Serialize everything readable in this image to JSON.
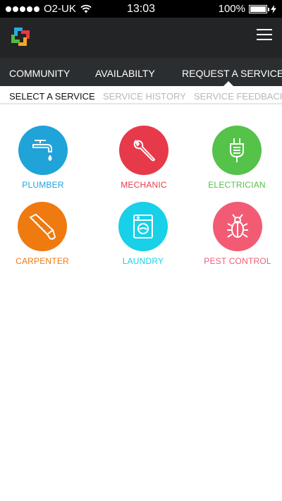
{
  "status_bar": {
    "carrier": "O2-UK",
    "time": "13:03",
    "battery": "100%",
    "battery_level": 1.0
  },
  "header": {
    "logo_icon": "app-logo-icon",
    "menu_icon": "hamburger-menu-icon"
  },
  "nav": {
    "items": [
      {
        "label": "COMMUNITY"
      },
      {
        "label": "AVAILABILTY"
      },
      {
        "label": "REQUEST A SERVICE",
        "selected": true
      }
    ]
  },
  "sub_tabs": {
    "items": [
      {
        "label": "SELECT A SERVICE",
        "active": true
      },
      {
        "label": "SERVICE HISTORY"
      },
      {
        "label": "SERVICE FEEDBACK"
      }
    ]
  },
  "services": [
    {
      "label": "PLUMBER",
      "icon": "faucet-icon",
      "color": "#1fa3d8"
    },
    {
      "label": "MECHANIC",
      "icon": "wrench-icon",
      "color": "#e63a4a"
    },
    {
      "label": "ELECTRICIAN",
      "icon": "plug-icon",
      "color": "#55c24a"
    },
    {
      "label": "CARPENTER",
      "icon": "saw-icon",
      "color": "#ee7a10"
    },
    {
      "label": "LAUNDRY",
      "icon": "washing-machine-icon",
      "color": "#18d0e8"
    },
    {
      "label": "PEST CONTROL",
      "icon": "bug-icon",
      "color": "#f25b73"
    }
  ]
}
